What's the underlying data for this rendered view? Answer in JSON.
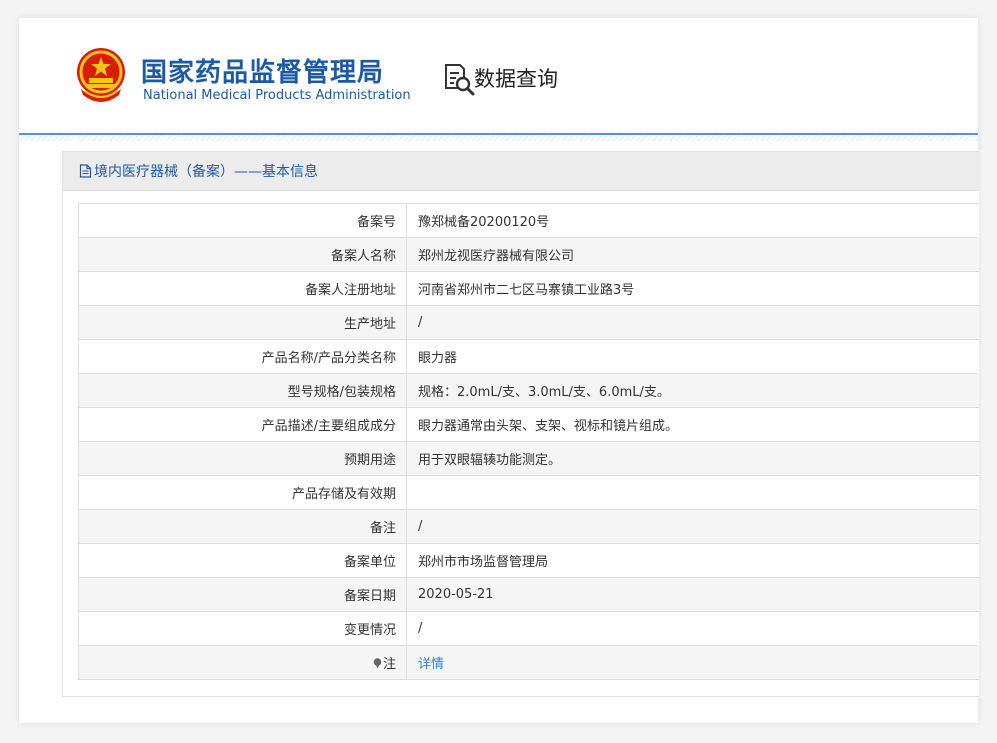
{
  "header": {
    "org_name_cn": "国家药品监督管理局",
    "org_name_en": "National Medical Products Administration",
    "query_label": "数据查询",
    "emblem_icon": "national-emblem-icon",
    "query_icon": "document-search-icon"
  },
  "panel": {
    "title": "境内医疗器械（备案）——基本信息",
    "title_icon": "document-icon"
  },
  "rows": [
    {
      "label": "备案号",
      "value": "豫郑械备20200120号"
    },
    {
      "label": "备案人名称",
      "value": "郑州龙视医疗器械有限公司"
    },
    {
      "label": "备案人注册地址",
      "value": "河南省郑州市二七区马寨镇工业路3号"
    },
    {
      "label": "生产地址",
      "value": "/"
    },
    {
      "label": "产品名称/产品分类名称",
      "value": "眼力器"
    },
    {
      "label": "型号规格/包装规格",
      "value": "规格：2.0mL/支、3.0mL/支、6.0mL/支。"
    },
    {
      "label": "产品描述/主要组成成分",
      "value": "眼力器通常由头架、支架、视标和镜片组成。"
    },
    {
      "label": "预期用途",
      "value": "用于双眼辐辏功能测定。"
    },
    {
      "label": "产品存储及有效期",
      "value": ""
    },
    {
      "label": "备注",
      "value": "/"
    },
    {
      "label": "备案单位",
      "value": "郑州市市场监督管理局"
    },
    {
      "label": "备案日期",
      "value": "2020-05-21"
    },
    {
      "label": "变更情况",
      "value": "/"
    }
  ],
  "note_row": {
    "label": "注",
    "link_text": "详情",
    "icon": "pin-icon"
  },
  "colors": {
    "brand_blue": "#1d5aa6",
    "link_blue": "#2f7fd8",
    "header_line": "#5b8fd6"
  }
}
